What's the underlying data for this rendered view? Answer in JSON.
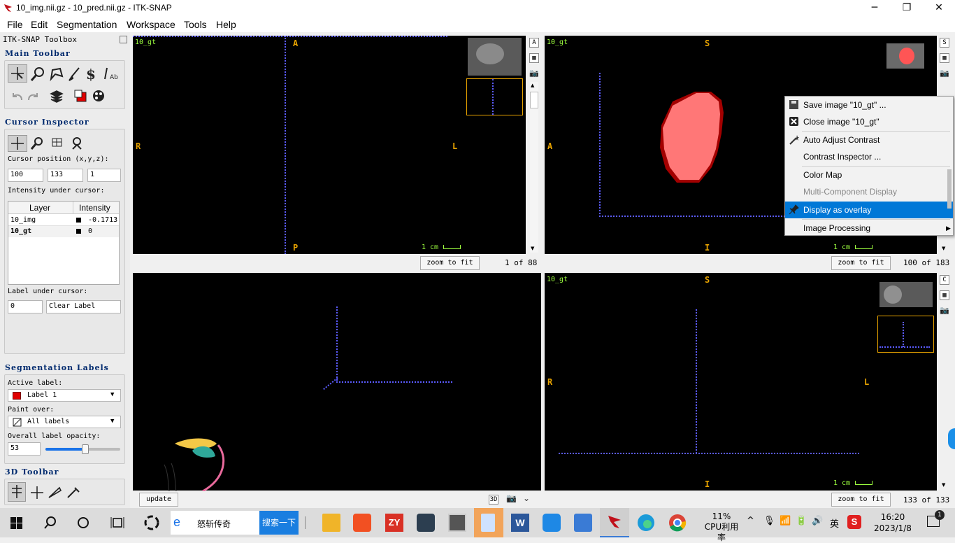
{
  "window": {
    "title": "10_img.nii.gz - 10_pred.nii.gz - ITK-SNAP",
    "minimize": "─",
    "maximize": "❐",
    "close": "✕"
  },
  "menu": [
    "File",
    "Edit",
    "Segmentation",
    "Workspace",
    "Tools",
    "Help"
  ],
  "toolbox": {
    "title": "ITK-SNAP Toolbox",
    "main_toolbar": "Main Toolbar",
    "cursor_inspector": "Cursor Inspector",
    "cursor_position_label": "Cursor position (x,y,z):",
    "cursor_position": [
      "100",
      "133",
      "1"
    ],
    "intensity_label": "Intensity under cursor:",
    "table_headers": [
      "Layer",
      "Intensity"
    ],
    "table_rows": [
      {
        "layer": "10_img",
        "intensity": "-0.1713"
      },
      {
        "layer": "10_gt",
        "intensity": "0"
      }
    ],
    "label_under_cursor": "Label under cursor:",
    "label_value": "0",
    "label_name": "Clear Label",
    "segmentation_labels": "Segmentation Labels",
    "active_label_label": "Active label:",
    "active_label": "Label 1",
    "active_label_color": "#e00000",
    "paint_over_label": "Paint over:",
    "paint_over": "All labels",
    "opacity_label": "Overall label opacity:",
    "opacity": "53",
    "toolbar_3d": "3D Toolbar"
  },
  "views": {
    "tl": {
      "layer": "10_gt",
      "top": "A",
      "left": "R",
      "right": "L",
      "bottom": "P",
      "scale": "1 cm",
      "zoom": "zoom to fit",
      "slice": "1 of 88",
      "side_letter": "A"
    },
    "tr": {
      "layer": "10_gt",
      "top": "S",
      "left": "A",
      "bottom": "I",
      "scale": "1 cm",
      "zoom": "zoom to fit",
      "slice": "100 of 183",
      "side_letter": "S"
    },
    "bl": {
      "update": "update",
      "btn_3d": "3D"
    },
    "br": {
      "layer": "10_gt",
      "top": "S",
      "left": "R",
      "right": "L",
      "bottom": "I",
      "scale": "1 cm",
      "zoom": "zoom to fit",
      "slice": "133 of 133",
      "side_letter": "C"
    }
  },
  "segmentation_colors": {
    "fill": "#ff7777",
    "border": "#a30000"
  },
  "context_menu": [
    {
      "label": "Save image \"10_gt\" ...",
      "icon": "save-icon"
    },
    {
      "label": "Close image \"10_gt\"",
      "icon": "close-box-icon"
    },
    {
      "label": "Auto Adjust Contrast",
      "icon": "wand-icon"
    },
    {
      "label": "Contrast Inspector ...",
      "icon": ""
    },
    {
      "label": "Color Map",
      "icon": ""
    },
    {
      "label": "Multi-Component Display",
      "icon": ""
    },
    {
      "label": "Display as overlay",
      "icon": "pin-icon"
    },
    {
      "label": "Image Processing",
      "icon": ""
    }
  ],
  "taskbar": {
    "search_text": "怒斩传奇",
    "search_button": "搜索一下",
    "cpu_percent": "11%",
    "cpu_label": "CPU利用率",
    "ime": "英",
    "time": "16:20",
    "date": "2023/1/8",
    "notifications": "1"
  }
}
